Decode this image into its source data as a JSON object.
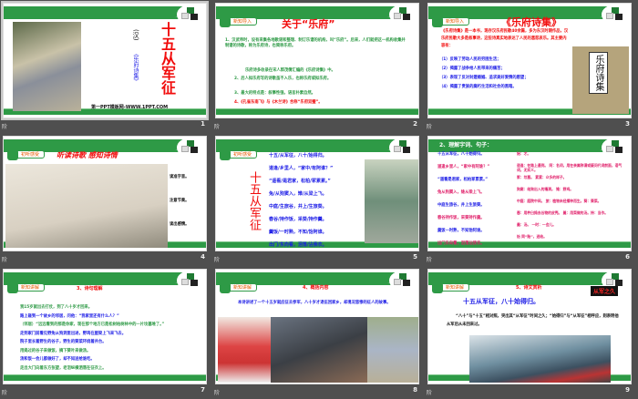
{
  "footer_label": "阶",
  "colors": {
    "green": "#2e9a46",
    "red": "#f10c0c",
    "blue": "#1a1ae6"
  },
  "slides": [
    {
      "number": "1",
      "title": "十五从军征",
      "dynasty": "(汉)",
      "source": "《乐府诗集》",
      "credit": "第一PPT模板网-WWW.1PPT.COM"
    },
    {
      "number": "2",
      "tag": "新知导入",
      "title": "关于“乐府”",
      "lines": [
        {
          "t": "1、汉武帝时，设有采集各地歌谣和整理、制订乐谱的机构，叫“乐府”。后来，人们就把这一机构收集并制谱的诗歌，称为乐府诗，也简称乐府。",
          "c": "g"
        },
        {
          "t": "乐府诗多收录在宋人郭茂倩汇编的《乐府诗集》中。",
          "c": "g"
        },
        {
          "t": "2、后人拟乐府写的诗歌虽不入乐，也称乐府或拟乐府。",
          "c": "g"
        },
        {
          "t": "3、最大的特点是：叙事性强，语言朴素自然。",
          "c": "g"
        },
        {
          "t": "4、《孔雀东南飞》与《木兰诗》合称“乐府双璧”。",
          "c": "r"
        }
      ]
    },
    {
      "number": "3",
      "tag": "新知导入",
      "title": "《乐府诗集》",
      "para": "《乐府诗集》是一本书，现存汉乐府民歌40余篇，多为东汉时期作品，汉乐府民歌大多是叙事诗，这些诗真实地表达了人民的喜怒哀乐。其主要内容有：",
      "items": [
        "（1）反映了劳动人民的穷困生活；",
        "（2）揭露了战争给人民带来的痛苦；",
        "（3）表现了反对封建婚姻、追求美好爱情的愿望；",
        "（4）揭露了贵族的腐朽生活和社会的黑暗。"
      ],
      "book_title": "乐府诗集"
    },
    {
      "number": "4",
      "tag": "初听感受",
      "title": "听读诗歌 感知诗情",
      "notes": [
        "读准字音。",
        "注意节奏。",
        "读出感情。"
      ]
    },
    {
      "number": "5",
      "tag": "初听感受",
      "title": "十五从军征",
      "poem": [
        "十五/从军征，八十/始得归。",
        "道逢/乡里人，“家中/有阿谁？”",
        "“遥看/是君家，松柏/冢累累。”",
        "兔/从狗窦入，雉/从梁上飞。",
        "中庭/生旅谷，井上/生旅葵。",
        "舂谷/持作饭，采葵/持作羹。",
        "羹饭/一时熟，不知/饴阿谁。",
        "出门/东向看，泪落/沾我衣。"
      ],
      "pinyin": [
        "ā",
        "bǎi zhǒng",
        "dòu  zhì  léi",
        "kuí",
        "chōng  gēng",
        "yí  ā"
      ]
    },
    {
      "number": "6",
      "title": "2、理解字词、句子：",
      "left": [
        "十五从军征，八十始得归。",
        "道逢乡里人，“家中有阿谁？”",
        "“遥看是君家，松柏冢累累。”",
        "兔从狗窦入，雉从梁上飞。",
        "中庭生旅谷，井上生旅葵。",
        "舂谷持作饭，采葵持作羹。",
        "羹饭一时熟，不知饴阿谁。",
        "出门东向看，泪落沾我衣。"
      ],
      "right": [
        "始：才。",
        "道逢：在路上遇到。 阿：名词，用在亲属称谓或疑问代词前面，语气词，无实义。",
        "冢：坟墓。 累累：众多的样子。",
        "狗窦：给狗出入的墙洞。 雉：野鸡。",
        "中庭：庭院中间。 旅：植物未经播种而生。葵：葵菜。",
        "舂：用杵臼捣去谷物的皮壳。 羹：用菜做的汤。持：当作。",
        "羹：汤。 一时：一会儿。",
        "饴 同“贻”，送给。"
      ]
    },
    {
      "number": "7",
      "tag": "新知讲解",
      "title": "3、诗句理解",
      "lines": [
        {
          "t": "我15岁就出去打仗，到了八十岁才回来。",
          "c": "g"
        },
        {
          "t": "路上碰到一个故乡的邻居，问他：“我家里还有什么人？”",
          "c": "b"
        },
        {
          "t": "（邻居）“远远看到的那是你家，现在那个地方已是松树柏树林中的一片坟墓堆了。”",
          "c": "g"
        },
        {
          "t": "走到家门前看见野兔从狗洞里出进，野鸡在屋梁上飞来飞去。",
          "c": "b"
        },
        {
          "t": "院子里长着野生的谷子，野生的葵菜环绕着井台。",
          "c": "b"
        },
        {
          "t": "用捣过的谷子来做饭，摘下葵叶来做汤。",
          "c": "g"
        },
        {
          "t": "汤和饭一会儿都做好了，却不知送给谁吃。",
          "c": "b"
        },
        {
          "t": "走出大门向着东方张望，老泪纵横洒落在征衣上。",
          "c": "g"
        }
      ]
    },
    {
      "number": "8",
      "tag": "新知讲解",
      "title": "4、概括内容",
      "para": "本诗讲述了一个十五岁就应征去参军，八十岁才退伍回家乡，却境况悲惨的征人的故事。"
    },
    {
      "number": "9",
      "tag": "新知讲解",
      "title": "5、诗文赏析",
      "badge": "从军之久",
      "headline": "十五从军征，八十始得归。",
      "para": "“八十”与“十五”相对照，突出其“从军征”时间之久；“始得归”与“从军征”相呼应，则表明他从军后从未回来过。"
    }
  ]
}
